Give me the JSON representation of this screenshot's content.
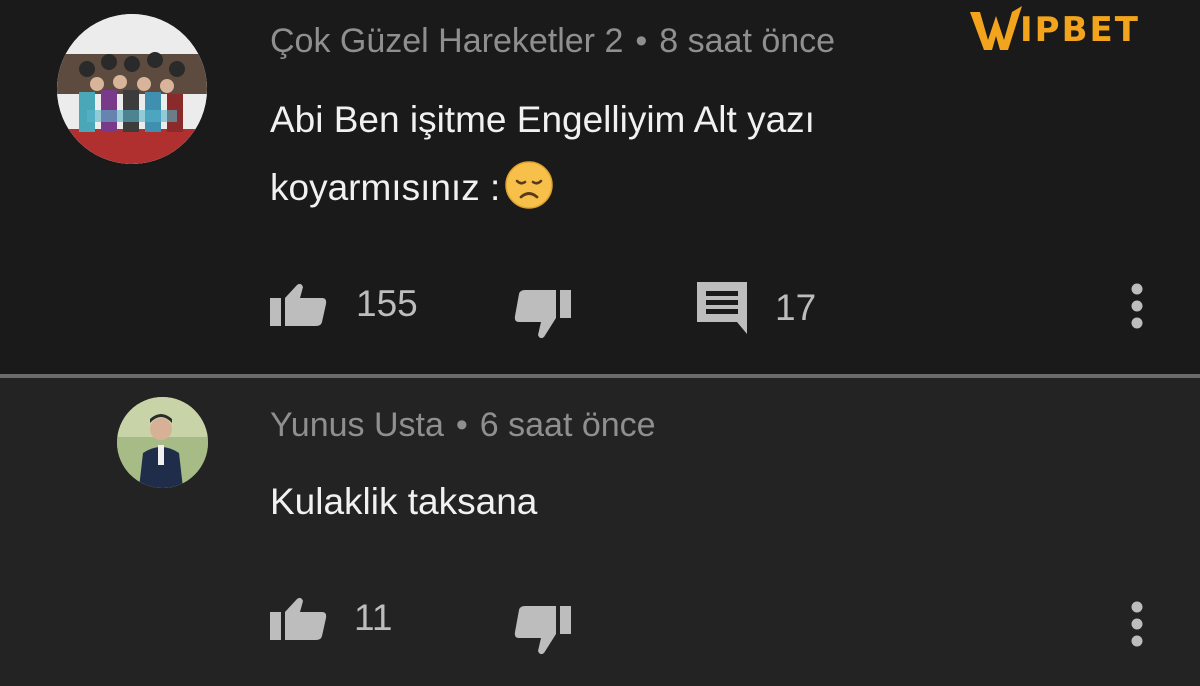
{
  "watermark": {
    "brand_text": "IPBET",
    "brand_color": "#f2a51c"
  },
  "comments": [
    {
      "author": "Çok Güzel Hareketler 2",
      "separator": "•",
      "time": "8 saat önce",
      "text_line1": "Abi Ben işitme Engelliyim Alt yazı",
      "text_line2": "koyarmısınız :",
      "emoji": "disappointed-face",
      "likes": "155",
      "replies": "17"
    },
    {
      "author": "Yunus Usta",
      "separator": "•",
      "time": "6 saat önce",
      "text_line1": "Kulaklik taksana",
      "likes": "11"
    }
  ],
  "icons": {
    "like": "thumbs-up-icon",
    "dislike": "thumbs-down-icon",
    "reply": "comment-icon",
    "menu": "more-vertical-icon"
  }
}
